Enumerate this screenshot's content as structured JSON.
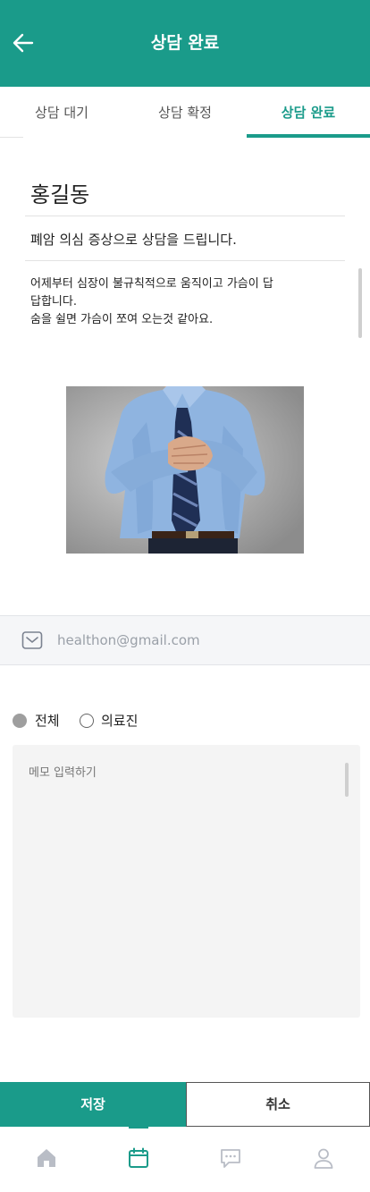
{
  "header": {
    "title": "상담 완료",
    "back_icon": "arrow-left-icon",
    "background_color": "#1a9b8a"
  },
  "tabs": [
    {
      "label": "상담 대기",
      "active": false
    },
    {
      "label": "상담 확정",
      "active": false
    },
    {
      "label": "상담 완료",
      "active": true
    }
  ],
  "consultation": {
    "patient_name": "홍길동",
    "subject": "폐암 의심 증상으로 상담을 드립니다.",
    "content": "어제부터 심장이 불규칙적으로 움직이고 가슴이 답\n답합니다.\n숨을 쉴면 가슴이 쪼여 오는것 같아요."
  },
  "contact": {
    "email": "healthon@gmail.com",
    "icon": "mail-icon"
  },
  "visibility": {
    "options": [
      {
        "label": "전체",
        "selected": true
      },
      {
        "label": "의료진",
        "selected": false
      }
    ]
  },
  "memo": {
    "placeholder": "메모 입력하기",
    "value": ""
  },
  "actions": {
    "save_label": "저장",
    "cancel_label": "취소"
  },
  "bottom_nav": {
    "items": [
      {
        "icon": "home-icon",
        "active": false
      },
      {
        "icon": "calendar-icon",
        "active": true
      },
      {
        "icon": "chat-icon",
        "active": false
      },
      {
        "icon": "person-icon",
        "active": false
      }
    ]
  },
  "colors": {
    "accent": "#1a9b8a",
    "memo_bg": "#f4f4f4"
  }
}
